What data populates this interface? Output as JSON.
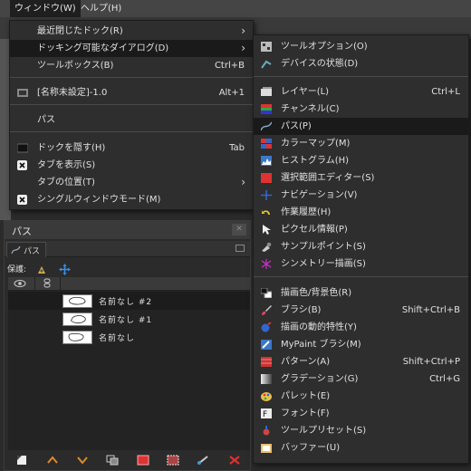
{
  "menubar": {
    "window": "ウィンドウ(W)",
    "help": "ヘルプ(H)"
  },
  "window_menu": {
    "items": [
      {
        "label": "最近閉じたドック(R)"
      },
      {
        "label": "ドッキング可能なダイアログ(D)"
      },
      {
        "label": "ツールボックス(B)",
        "accel": "Ctrl+B"
      },
      {
        "label": "[名称未設定]-1.0",
        "accel": "Alt+1"
      },
      {
        "label": "パス"
      },
      {
        "label": "ドックを隠す(H)",
        "accel": "Tab"
      },
      {
        "label": "タブを表示(S)"
      },
      {
        "label": "タブの位置(T)"
      },
      {
        "label": "シングルウィンドウモード(M)"
      }
    ]
  },
  "dockable_menu": {
    "items": [
      {
        "label": "ツールオプション(O)",
        "accel": ""
      },
      {
        "label": "デバイスの状態(D)",
        "accel": ""
      },
      {
        "label": "レイヤー(L)",
        "accel": "Ctrl+L"
      },
      {
        "label": "チャンネル(C)",
        "accel": ""
      },
      {
        "label": "パス(P)",
        "accel": ""
      },
      {
        "label": "カラーマップ(M)",
        "accel": ""
      },
      {
        "label": "ヒストグラム(H)",
        "accel": ""
      },
      {
        "label": "選択範囲エディター(S)",
        "accel": ""
      },
      {
        "label": "ナビゲーション(V)",
        "accel": ""
      },
      {
        "label": "作業履歴(H)",
        "accel": ""
      },
      {
        "label": "ピクセル情報(P)",
        "accel": ""
      },
      {
        "label": "サンプルポイント(S)",
        "accel": ""
      },
      {
        "label": "シンメトリー描画(S)",
        "accel": ""
      },
      {
        "label": "描画色/背景色(R)",
        "accel": ""
      },
      {
        "label": "ブラシ(B)",
        "accel": "Shift+Ctrl+B"
      },
      {
        "label": "描画の動的特性(Y)",
        "accel": ""
      },
      {
        "label": "MyPaint ブラシ(M)",
        "accel": ""
      },
      {
        "label": "パターン(A)",
        "accel": "Shift+Ctrl+P"
      },
      {
        "label": "グラデーション(G)",
        "accel": "Ctrl+G"
      },
      {
        "label": "パレット(E)",
        "accel": ""
      },
      {
        "label": "フォント(F)",
        "accel": ""
      },
      {
        "label": "ツールプリセット(S)",
        "accel": ""
      },
      {
        "label": "バッファー(U)",
        "accel": ""
      }
    ]
  },
  "paths_dock": {
    "title": "パス",
    "tab_label": "パス",
    "lock_label": "保護:",
    "paths": [
      {
        "name": "名前なし #2"
      },
      {
        "name": "名前なし #1"
      },
      {
        "name": "名前なし"
      }
    ]
  }
}
